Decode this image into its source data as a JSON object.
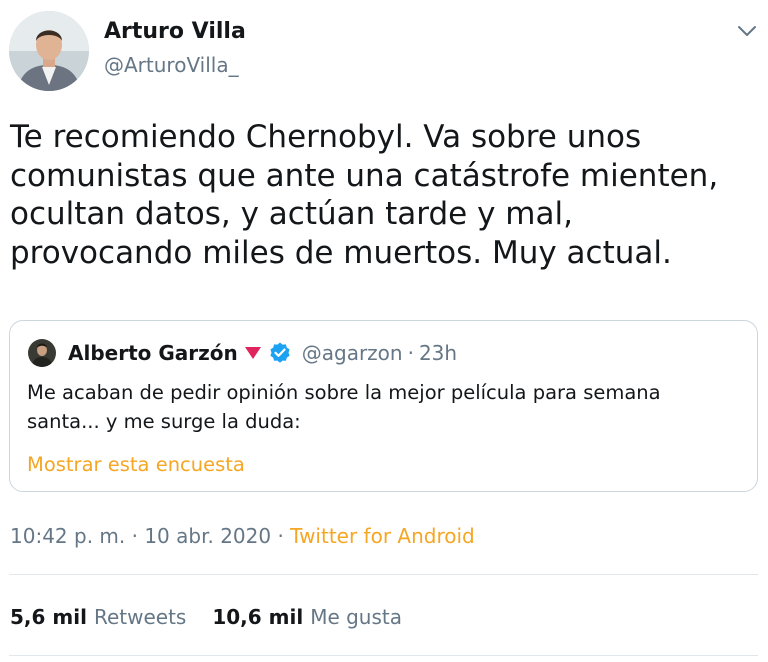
{
  "author": {
    "name": "Arturo Villa",
    "handle": "@ArturoVilla_"
  },
  "tweet": {
    "lines": [
      "Te recomiendo Chernobyl. Va sobre unos",
      "comunistas que ante una catástrofe mienten,",
      "ocultan datos, y actúan tarde y mal,",
      "provocando miles de muertos. Muy actual."
    ]
  },
  "quoted": {
    "name": "Alberto Garzón",
    "handle": "@agarzon",
    "separator": "·",
    "time": "23h",
    "text_lines": [
      "Me acaban de pedir opinión sobre la mejor película para semana",
      "santa... y me surge la duda:"
    ],
    "link": "Mostrar esta encuesta"
  },
  "meta": {
    "time": "10:42 p. m.",
    "sep1": " · ",
    "date": "10 abr. 2020",
    "sep2": " · ",
    "source": "Twitter for Android"
  },
  "stats": {
    "retweets_count": "5,6 mil",
    "retweets_label": "Retweets",
    "likes_count": "10,6 mil",
    "likes_label": "Me gusta"
  },
  "icons": {
    "caret": "chevron-down-icon",
    "verified": "verified-badge-icon",
    "triangle": "red-triangle-icon"
  },
  "colors": {
    "link": "#f5a623",
    "secondary_text": "#657786",
    "verified": "#1da1f2",
    "triangle": "#e0245e"
  }
}
